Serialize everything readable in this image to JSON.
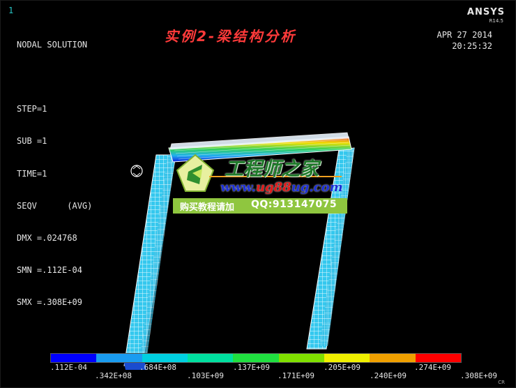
{
  "viewport": {
    "window_number": "1",
    "brand": "ANSYS",
    "version": "R14.5",
    "title": "实例2-梁结构分析",
    "date": "APR 27 2014",
    "time": "20:25:32",
    "corner_label": "CR"
  },
  "solution_info": [
    "NODAL SOLUTION",
    "",
    "STEP=1",
    "SUB =1",
    "TIME=1",
    "SEQV      (AVG)",
    "DMX =.024768",
    "SMN =.112E-04",
    "SMX =.308E+09"
  ],
  "watermark": {
    "name": "工程师之家",
    "url_pre": "www.",
    "url_hl": "ug88",
    "url_post": "ug.com",
    "buy": "购买教程请加",
    "qq": "QQ:913147075"
  },
  "legend": {
    "colors": [
      "#0000ff",
      "#1a9cf0",
      "#00d0e0",
      "#00e0a0",
      "#20e040",
      "#80e000",
      "#f0f000",
      "#f0a000",
      "#ff0000"
    ],
    "labels_top": [
      ".112E-04",
      ".684E+08",
      ".137E+09",
      ".205E+09",
      ".274E+09"
    ],
    "labels_bottom": [
      ".342E+08",
      ".103E+09",
      ".171E+09",
      ".240E+09",
      ".308E+09"
    ]
  }
}
